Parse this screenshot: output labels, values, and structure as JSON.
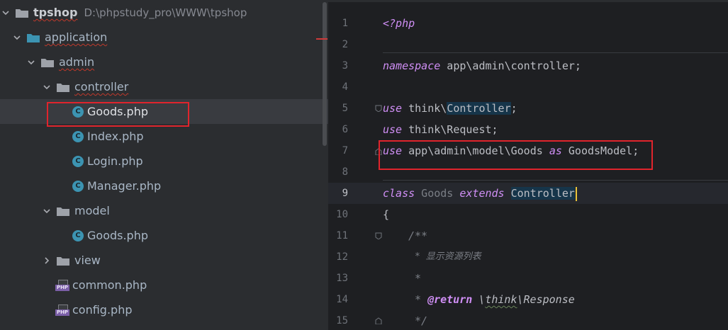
{
  "project_tree": {
    "root": {
      "name": "tpshop",
      "path": "D:\\phpstudy_pro\\WWW\\tpshop"
    },
    "application": "application",
    "admin": "admin",
    "controller": "controller",
    "controller_files": [
      "Goods.php",
      "Index.php",
      "Login.php",
      "Manager.php"
    ],
    "model": "model",
    "model_files": [
      "Goods.php"
    ],
    "view": "view",
    "root_files": [
      "common.php",
      "config.php"
    ],
    "selected_file": "Goods.php",
    "class_icon_letter": "C",
    "php_icon_label": "PHP"
  },
  "editor": {
    "line_numbers": [
      "1",
      "2",
      "3",
      "4",
      "5",
      "6",
      "7",
      "8",
      "9",
      "10",
      "11",
      "12",
      "13",
      "14",
      "15"
    ],
    "current_line": "9",
    "code": {
      "l1_open": "<?php",
      "l3_kw": "namespace",
      "l3_rest": " app\\admin\\controller;",
      "l5_kw": "use",
      "l5_a": " think\\",
      "l5_b": "Controller",
      "l5_c": ";",
      "l6_kw": "use",
      "l6_rest": " think\\Request;",
      "l7_kw": "use",
      "l7_a": " app\\admin\\model\\Goods ",
      "l7_as": "as",
      "l7_b": " GoodsModel;",
      "l9_kw": "class",
      "l9_name": " Goods ",
      "l9_ext": "extends",
      "l9_sp": " ",
      "l9_parent": "Controller",
      "l10": "{",
      "l11": "/**",
      "l12": "* 显示资源列表",
      "l13": "*",
      "l14_star": "* ",
      "l14_tag": "@return",
      "l14_sp": " ",
      "l14_a": "\\",
      "l14_b": "think",
      "l14_c": "\\Response",
      "l15": "*/"
    }
  },
  "colors": {
    "highlight_box": "#e0242c",
    "keyword": "#cf8ef4",
    "class_icon": "#3c94b2",
    "php_tag": "#7b5fa8"
  }
}
